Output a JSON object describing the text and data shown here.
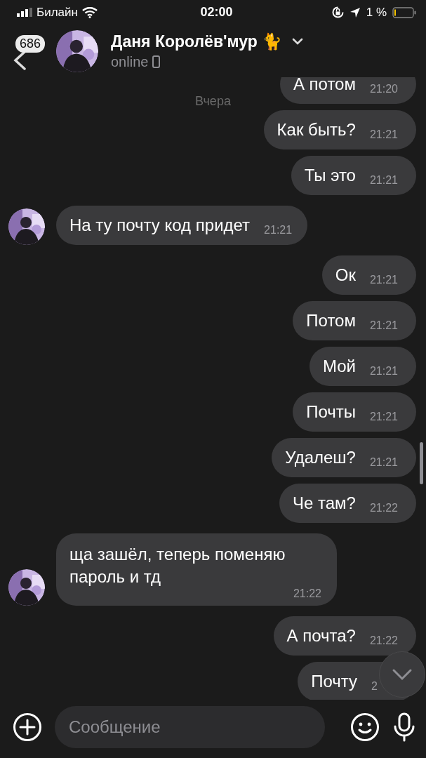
{
  "status_bar": {
    "carrier": "Билайн",
    "time": "02:00",
    "battery": "1 %"
  },
  "header": {
    "back_badge": "686",
    "contact_name": "Даня Королёв'мур 🐈",
    "presence": "online"
  },
  "date_label": "Вчера",
  "messages": [
    {
      "kind": "out",
      "text": "А потом",
      "time": "21:20"
    },
    {
      "kind": "out",
      "text": "Как быть?",
      "time": "21:21"
    },
    {
      "kind": "out",
      "text": "Ты это",
      "time": "21:21"
    },
    {
      "kind": "in",
      "text": "На ту почту код придет",
      "time": "21:21"
    },
    {
      "kind": "out",
      "text": "Ок",
      "time": "21:21"
    },
    {
      "kind": "out",
      "text": "Потом",
      "time": "21:21"
    },
    {
      "kind": "out",
      "text": "Мой",
      "time": "21:21"
    },
    {
      "kind": "out",
      "text": "Почты",
      "time": "21:21"
    },
    {
      "kind": "out",
      "text": "Удалеш?",
      "time": "21:21"
    },
    {
      "kind": "out",
      "text": "Че там?",
      "time": "21:22"
    },
    {
      "kind": "in",
      "text": "ща зашёл, теперь поменяю пароль и тд",
      "time": "21:22"
    },
    {
      "kind": "out",
      "text": "А почта?",
      "time": "21:22"
    },
    {
      "kind": "out",
      "text": "Почту",
      "time": "2"
    }
  ],
  "composer": {
    "placeholder": "Сообщение"
  }
}
